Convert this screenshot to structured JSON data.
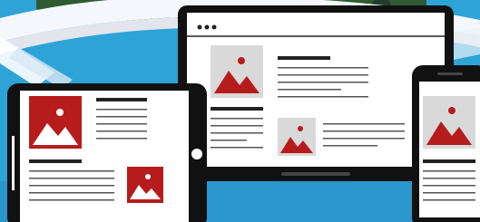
{
  "colors": {
    "sky_blue": "#2ea3d6",
    "deep_blue": "#1f79b9",
    "arc_white": "#f4f7fb",
    "arc_gray": "#e2e6ec",
    "foliage_dark": "#1f3d28",
    "foliage_mid": "#3f6b3a",
    "device_frame": "#111111",
    "screen_white": "#ffffff",
    "placeholder_gray": "#d9d9d9",
    "image_red": "#b71c1c",
    "text_line_dark": "#222222",
    "text_line_light": "#555555"
  },
  "devices": [
    {
      "name": "tablet",
      "icons": [
        "image-placeholder-icon",
        "image-placeholder-icon"
      ]
    },
    {
      "name": "laptop",
      "icons": [
        "browser-dots-icon",
        "image-placeholder-icon",
        "image-placeholder-icon"
      ]
    },
    {
      "name": "phone",
      "icons": [
        "image-placeholder-icon"
      ]
    }
  ]
}
